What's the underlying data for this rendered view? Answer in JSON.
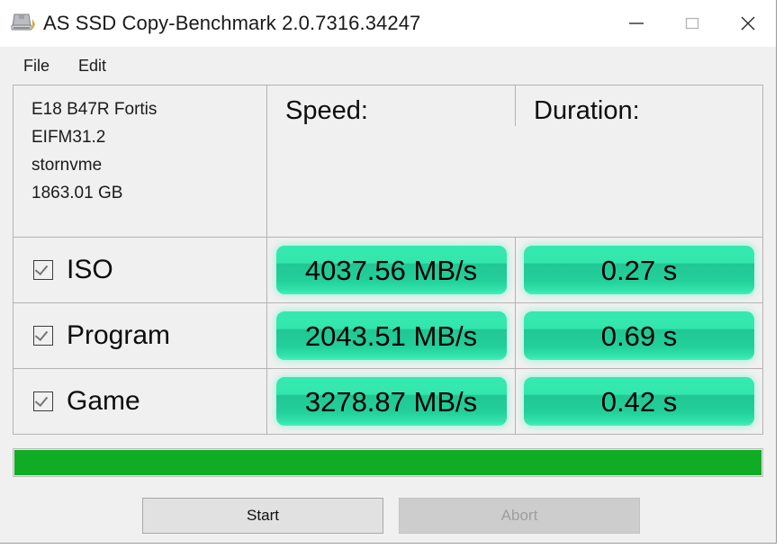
{
  "window": {
    "title": "AS SSD Copy-Benchmark 2.0.7316.34247",
    "app_icon": "ssd-drive-icon",
    "controls": {
      "minimize": "minimize-icon",
      "maximize": "maximize-icon",
      "close": "close-icon"
    }
  },
  "menu": {
    "items": [
      {
        "label": "File"
      },
      {
        "label": "Edit"
      }
    ]
  },
  "drive": {
    "model": "E18 B47R Fortis",
    "firmware": "EIFM31.2",
    "driver": "stornvme",
    "capacity": "1863.01 GB"
  },
  "table": {
    "headers": {
      "speed": "Speed:",
      "duration": "Duration:"
    },
    "rows": [
      {
        "name": "ISO",
        "checked": true,
        "speed": "4037.56 MB/s",
        "duration": "0.27 s"
      },
      {
        "name": "Program",
        "checked": true,
        "speed": "2043.51 MB/s",
        "duration": "0.69 s"
      },
      {
        "name": "Game",
        "checked": true,
        "speed": "3278.87 MB/s",
        "duration": "0.42 s"
      }
    ]
  },
  "progress": {
    "percent": 100,
    "fill_color": "#11ac25"
  },
  "buttons": {
    "start": {
      "label": "Start",
      "enabled": true
    },
    "abort": {
      "label": "Abort",
      "enabled": false
    }
  },
  "colors": {
    "result_pill_green": "#2ddfa8",
    "window_background": "#f0f0f0",
    "titlebar_background": "#ffffff"
  }
}
